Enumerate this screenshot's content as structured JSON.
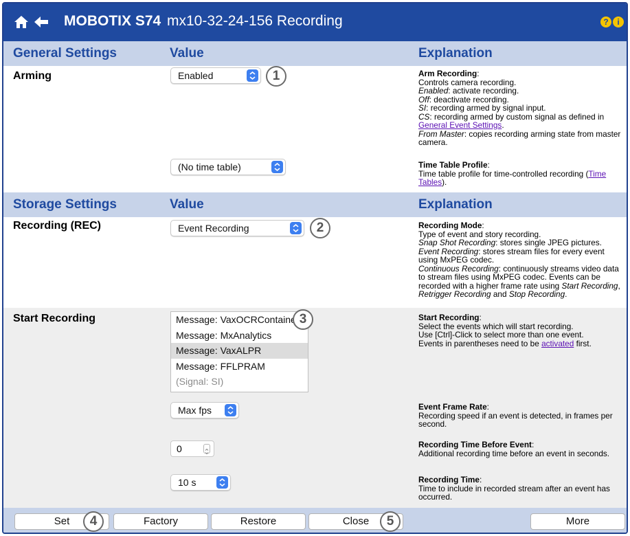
{
  "header": {
    "brand": "MOBOTIX S74",
    "subtitle": "mx10-32-24-156 Recording",
    "icons": [
      "home-icon",
      "back-arrow-icon",
      "help-icon",
      "info-icon"
    ],
    "help_glyph": "?",
    "info_glyph": "i"
  },
  "colors": {
    "title_bar": "#1f4aa0",
    "section_header": "#c7d3e9",
    "section_text": "#1f4aa0",
    "link": "#5a0fb3",
    "accent_icon": "#f5c400",
    "select_chevron": "#3d7ff0"
  },
  "general": {
    "header": {
      "col1": "General Settings",
      "col2": "Value",
      "col3": "Explanation"
    },
    "arming": {
      "label": "Arming",
      "value": "Enabled",
      "callout": "1",
      "expl": {
        "title": "Arm Recording",
        "l1": "Controls camera recording.",
        "enabled_term": "Enabled",
        "enabled_text": ": activate recording.",
        "off_term": "Off",
        "off_text": ": deactivate recording.",
        "si_term": "SI",
        "si_text": ": recording armed by signal input.",
        "cs_term": "CS",
        "cs_text": ": recording armed by custom signal as defined in",
        "cs_link": "General Event Settings",
        "master_term": "From Master",
        "master_text": ": copies recording arming state from master camera."
      }
    },
    "timetable": {
      "value": "(No time table)",
      "expl": {
        "title": "Time Table Profile",
        "text": "Time table profile for time-controlled recording (",
        "link": "Time Tables",
        "tail": ")."
      }
    }
  },
  "storage": {
    "header": {
      "col1": "Storage Settings",
      "col2": "Value",
      "col3": "Explanation"
    },
    "rec": {
      "label": "Recording (REC)",
      "value": "Event Recording",
      "callout": "2",
      "expl": {
        "title": "Recording Mode",
        "l1": "Type of event and story recording.",
        "snap_term": "Snap Shot Recording",
        "snap_text": ": stores single JPEG pictures.",
        "event_term": "Event Recording",
        "event_text": ": stores stream files for every event using MxPEG codec.",
        "cont_term": "Continuous Recording",
        "cont_text": ": continuously streams video data to stream files using MxPEG codec. Events can be recorded with a higher frame rate using",
        "start_term": "Start Recording",
        "comma": ",",
        "retrigger_term": "Retrigger Recording",
        "and": "and",
        "stop_term": "Stop Recording",
        "period": "."
      }
    },
    "start": {
      "label": "Start Recording",
      "callout": "3",
      "events": [
        {
          "text": "Message: VaxOCRContainer",
          "state": "normal"
        },
        {
          "text": "Message: MxAnalytics",
          "state": "normal"
        },
        {
          "text": "Message: VaxALPR",
          "state": "selected"
        },
        {
          "text": "Message: FFLPRAM",
          "state": "normal"
        },
        {
          "text": "(Signal: SI)",
          "state": "disabled"
        }
      ],
      "expl": {
        "title": "Start Recording",
        "l1": "Select the events which will start recording.",
        "l2": "Use [Ctrl]-Click to select more than one event.",
        "l3": "Events in parentheses need to be",
        "link": "activated",
        "l3_tail": "first."
      }
    },
    "framerate": {
      "value": "Max fps",
      "expl": {
        "title": "Event Frame Rate",
        "text": "Recording speed if an event is detected, in frames per second."
      }
    },
    "before": {
      "value": "0",
      "expl": {
        "title": "Recording Time Before Event",
        "text": "Additional recording time before an event in seconds."
      }
    },
    "rectime": {
      "value": "10 s",
      "expl": {
        "title": "Recording Time",
        "text": "Time to include in recorded stream after an event has occurred."
      }
    }
  },
  "buttons": {
    "set": "Set",
    "factory": "Factory",
    "restore": "Restore",
    "close": "Close",
    "more": "More",
    "callout_set": "4",
    "callout_close": "5"
  }
}
